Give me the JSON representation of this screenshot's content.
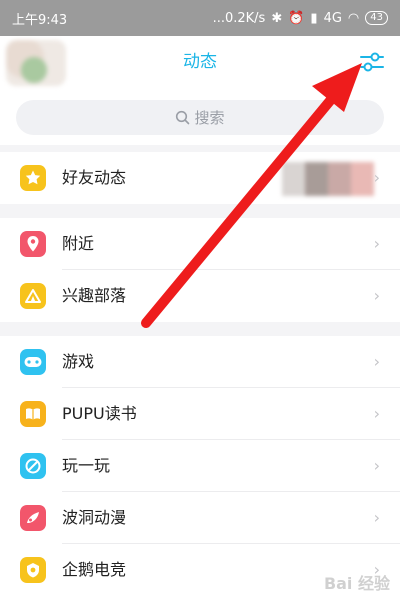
{
  "status_bar": {
    "time": "上午9:43",
    "speed": "...0.2K/s",
    "network": "4G",
    "battery": "43"
  },
  "header": {
    "title": "动态"
  },
  "search": {
    "placeholder": "搜索"
  },
  "sections": [
    {
      "items": [
        {
          "label": "好友动态",
          "icon": "star-icon",
          "color": "#f7c31c"
        }
      ]
    },
    {
      "items": [
        {
          "label": "附近",
          "icon": "location-pin-icon",
          "color": "#f2566b"
        },
        {
          "label": "兴趣部落",
          "icon": "tent-icon",
          "color": "#f7c31c"
        }
      ]
    },
    {
      "items": [
        {
          "label": "游戏",
          "icon": "gamepad-icon",
          "color": "#2fc2f0"
        },
        {
          "label": "PUPU读书",
          "icon": "book-icon",
          "color": "#f7b21c"
        },
        {
          "label": "玩一玩",
          "icon": "play-leaf-icon",
          "color": "#2fc2f0"
        },
        {
          "label": "波洞动漫",
          "icon": "comic-icon",
          "color": "#f2566b"
        },
        {
          "label": "企鹅电竞",
          "icon": "esports-icon",
          "color": "#f7c31c"
        }
      ]
    }
  ],
  "chevron": "›",
  "watermark": "Bai 经验"
}
